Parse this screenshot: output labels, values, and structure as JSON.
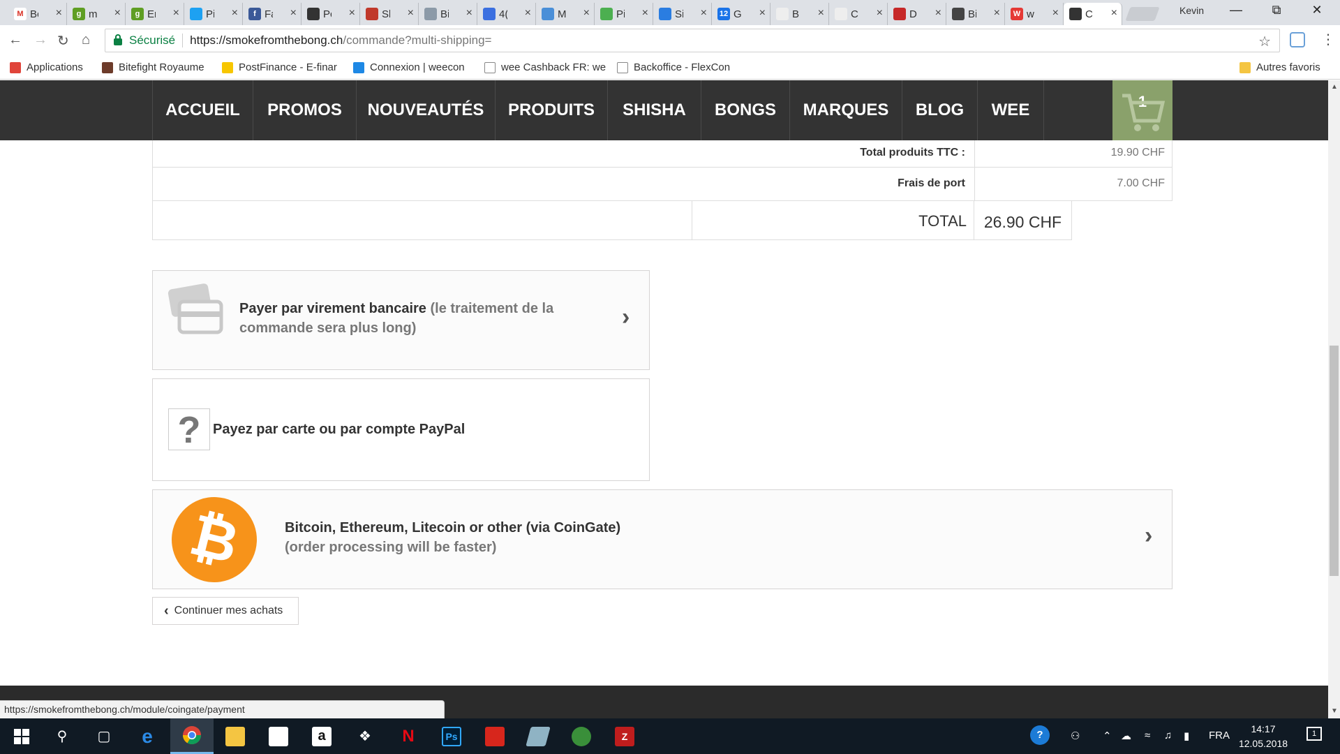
{
  "browser": {
    "tabs": [
      {
        "title": "Bo",
        "fav_color": "#ffffff",
        "fav_text": "M",
        "fav_text_color": "#d93025"
      },
      {
        "title": "m",
        "fav_color": "#5f9e23",
        "fav_text": "g",
        "fav_text_color": "#ffffff"
      },
      {
        "title": "Er",
        "fav_color": "#5f9e23",
        "fav_text": "g",
        "fav_text_color": "#ffffff"
      },
      {
        "title": "Pi",
        "fav_color": "#1da1f2",
        "fav_text": "",
        "fav_text_color": "#ffffff"
      },
      {
        "title": "Fa",
        "fav_color": "#3b5998",
        "fav_text": "f",
        "fav_text_color": "#ffffff"
      },
      {
        "title": "Pc",
        "fav_color": "#333333",
        "fav_text": "",
        "fav_text_color": "#ffffff"
      },
      {
        "title": "Sl",
        "fav_color": "#c0392b",
        "fav_text": "",
        "fav_text_color": "#ffffff"
      },
      {
        "title": "Bi",
        "fav_color": "#8c9aa8",
        "fav_text": "",
        "fav_text_color": "#ffffff"
      },
      {
        "title": "4(",
        "fav_color": "#3b6fe0",
        "fav_text": "",
        "fav_text_color": "#ffffff"
      },
      {
        "title": "M",
        "fav_color": "#4a8fd8",
        "fav_text": "",
        "fav_text_color": "#ffffff"
      },
      {
        "title": "Pi",
        "fav_color": "#4caf50",
        "fav_text": "",
        "fav_text_color": "#ffffff"
      },
      {
        "title": "Si",
        "fav_color": "#2a7de1",
        "fav_text": "",
        "fav_text_color": "#ffffff"
      },
      {
        "title": "G",
        "fav_color": "#1a73e8",
        "fav_text": "12",
        "fav_text_color": "#ffffff"
      },
      {
        "title": "B",
        "fav_color": "#eeeeee",
        "fav_text": "",
        "fav_text_color": "#555555"
      },
      {
        "title": "C",
        "fav_color": "#eeeeee",
        "fav_text": "",
        "fav_text_color": "#555555"
      },
      {
        "title": "D",
        "fav_color": "#c62828",
        "fav_text": "",
        "fav_text_color": "#ffffff"
      },
      {
        "title": "Bi",
        "fav_color": "#444444",
        "fav_text": "",
        "fav_text_color": "#ffffff"
      },
      {
        "title": "w",
        "fav_color": "#e53935",
        "fav_text": "W",
        "fav_text_color": "#ffffff"
      },
      {
        "title": "C",
        "fav_color": "#333333",
        "fav_text": "",
        "fav_text_color": "#ffffff",
        "active": true
      }
    ],
    "profile_name": "Kevin",
    "security_label": "Sécurisé",
    "url_host": "https://smokefromthebong.ch",
    "url_path": "/commande?multi-shipping=",
    "bookmarks": [
      {
        "label": "Applications",
        "color": "#e0443a"
      },
      {
        "label": "Bitefight Royaume",
        "color": "#6d3b2a"
      },
      {
        "label": "PostFinance - E-finar",
        "color": "#f7c600"
      },
      {
        "label": "Connexion | weecon",
        "color": "#1e88e5"
      },
      {
        "label": "wee Cashback FR: we",
        "color": "#ffffff"
      },
      {
        "label": "Backoffice - FlexCon",
        "color": "#ffffff"
      }
    ],
    "other_bookmarks": "Autres favoris",
    "status_url": "https://smokefromthebong.ch/module/coingate/payment"
  },
  "site": {
    "nav": [
      "ACCUEIL",
      "PROMOS",
      "NOUVEAUTÉS",
      "PRODUITS",
      "SHISHA",
      "BONGS",
      "MARQUES",
      "BLOG",
      "WEE"
    ],
    "cart_count": "1",
    "totals": {
      "products_label": "Total produits TTC :",
      "products_value": "19.90 CHF",
      "shipping_label": "Frais de port",
      "shipping_value": "7.00 CHF",
      "total_label": "TOTAL",
      "total_value": "26.90 CHF"
    },
    "payments": {
      "bank_main": "Payer par virement bancaire",
      "bank_note": "(le traitement de la commande sera plus long)",
      "paypal": "Payez par carte ou par compte PayPal",
      "crypto_main": "Bitcoin, Ethereum, Litecoin or other (via CoinGate)",
      "crypto_note": "(order processing will be faster)",
      "question_glyph": "?",
      "bitcoin_glyph": "₿"
    },
    "continue_label": "Continuer mes achats"
  },
  "taskbar": {
    "language": "FRA",
    "time": "14:17",
    "date": "12.05.2018",
    "notifications": "1"
  }
}
